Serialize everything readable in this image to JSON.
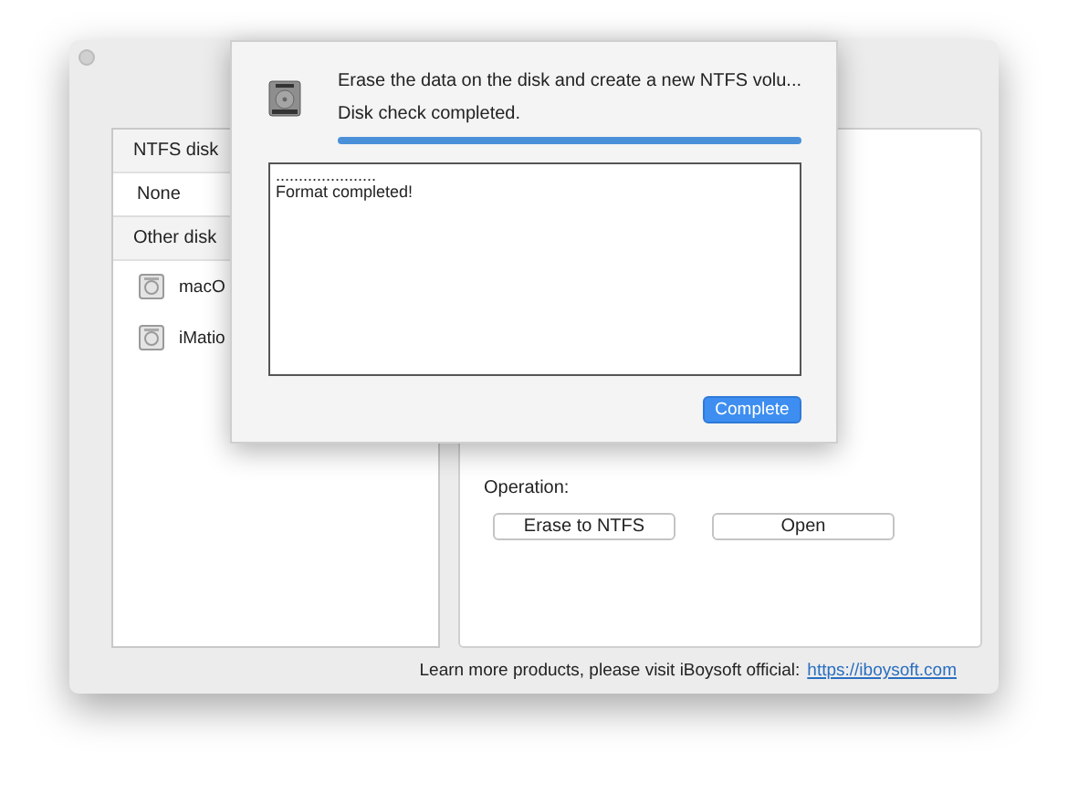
{
  "sidebar": {
    "sections": [
      {
        "title": "NTFS disk",
        "items": [
          {
            "kind": "text",
            "label": "None"
          }
        ]
      },
      {
        "title": "Other disk",
        "items": [
          {
            "kind": "disk",
            "label": "macO"
          },
          {
            "kind": "disk",
            "label": "iMatio"
          }
        ]
      }
    ]
  },
  "operation": {
    "label": "Operation:",
    "buttons": [
      "Erase to NTFS",
      "Open"
    ]
  },
  "footer": {
    "text": "Learn more products, please visit iBoysoft official:",
    "link": "https://iboysoft.com"
  },
  "dialog": {
    "message": "Erase the data on the disk and create a new NTFS volu...",
    "status": "Disk check completed.",
    "progress": {
      "level": 1
    },
    "log": [
      "......................",
      "Format completed!"
    ],
    "button": "Complete"
  }
}
